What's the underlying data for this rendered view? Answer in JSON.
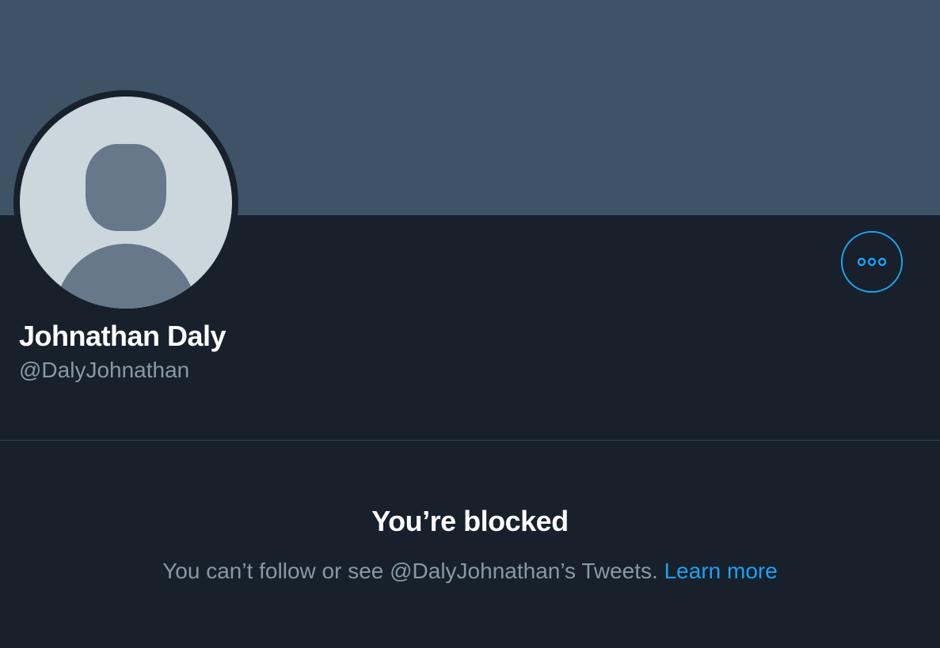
{
  "profile": {
    "display_name": "Johnathan Daly",
    "handle": "@DalyJohnathan",
    "avatar_icon": "default-avatar-icon",
    "more_icon": "more-horizontal-icon"
  },
  "blocked": {
    "title": "You’re blocked",
    "message": "You can’t follow or see @DalyJohnathan’s Tweets.",
    "learn_more": "Learn more"
  },
  "colors": {
    "background": "#17202B",
    "banner": "#3E5366",
    "accent": "#1DA1F2",
    "secondary_text": "#8899A6",
    "avatar_bg": "#CCD6DD",
    "avatar_silhouette": "#66788A"
  }
}
